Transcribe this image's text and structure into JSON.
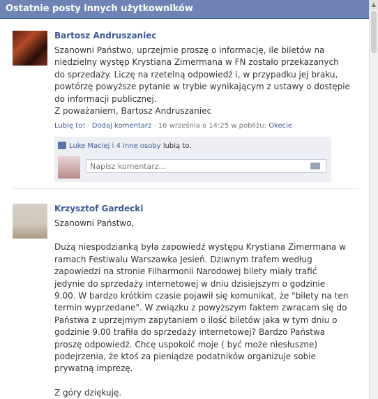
{
  "header": {
    "title": "Ostatnie posty innych użytkowników"
  },
  "posts": [
    {
      "author": "Bartosz Andruszaniec",
      "message": [
        "Szanowni Państwo, uprzejmie proszę o informację, ile biletów na",
        "niedzielny występ Krystiana Zimermana w FN zostało przekazanych",
        "do sprzedaży. Liczę na rzetelną odpowiedź i, w przypadku jej braku,",
        "powtórzę powyższe pytanie w trybie wynikającym z ustawy o dostępie",
        "do informacji publicznej.",
        "Z poważaniem, Bartosz Andruszaniec"
      ],
      "like_link": "Lubię to!",
      "sep1": " · ",
      "comment_link": "Dodaj komentarz",
      "sep2": " · ",
      "timestamp": "16 września o 14:25 w pobliżu: ",
      "location": "Okecie",
      "likes_names": "Luke Maciej i 4 inne osoby",
      "likes_suffix": " lubią to.",
      "comment_placeholder": "Napisz komentarz..."
    },
    {
      "author": "Krzysztof Gardecki",
      "greeting": "Szanowni Państwo,",
      "message": [
        "Dużą niespodzianką była zapowiedź występu Krystiana Zimermana w",
        "ramach Festiwalu Warszawka Jesień. Dziwnym trafem według",
        "zapowiedzi na stronie Filharmonii Narodowej bilety miały trafić",
        "jedynie do sprzedaży internetowej w dniu dzisiejszym o godzinie",
        "9.00. W bardzo krótkim czasie pojawił się komunikat, że \"bilety na ten",
        "termin wyprzedane\". W związku z powyższym faktem zwracam się do",
        "Państwa z uprzejmym zapytaniem o ilość biletów jaka w tym dniu o",
        "godzinie 9.00 trafiła do sprzedaży internetowej? Bardzo Państwa",
        "proszę odpowiedź. Chcę uspokoić moje ( być może niesłuszne)",
        "podejrzenia, że ktoś za pieniądze podatników organizuje sobie",
        "prywatną imprezę."
      ],
      "closing": "Z góry dziękuję."
    }
  ]
}
